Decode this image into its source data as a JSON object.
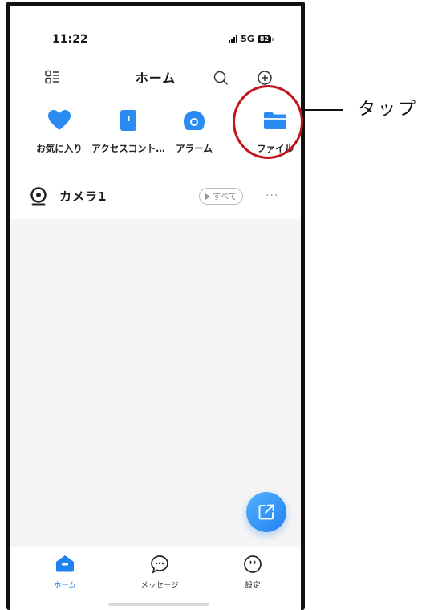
{
  "status_bar": {
    "time": "11:22",
    "network": "5G",
    "battery": "82"
  },
  "header": {
    "title": "ホーム",
    "icons": [
      "list-menu-icon",
      "search-icon",
      "add-icon"
    ]
  },
  "quick_actions": [
    {
      "label": "お気に入り",
      "icon": "heart-icon",
      "color": "#2a8bf2"
    },
    {
      "label": "アクセスコント…",
      "icon": "access-control-icon",
      "color": "#2a8bf2"
    },
    {
      "label": "アラーム",
      "icon": "alarm-icon",
      "color": "#2a8bf2"
    },
    {
      "label": "ファイル",
      "icon": "folder-icon",
      "color": "#2a8bf2"
    }
  ],
  "camera_row": {
    "name": "カメラ1",
    "view_all_label": "すべて",
    "more_label": "···"
  },
  "tab_bar": {
    "tabs": [
      {
        "label": "ホーム",
        "icon": "home-icon",
        "active": true
      },
      {
        "label": "メッセージ",
        "icon": "message-icon",
        "active": false
      },
      {
        "label": "設定",
        "icon": "settings-icon",
        "active": false
      }
    ]
  },
  "annotation": {
    "text": "タップ",
    "circle_color": "#c0141b"
  },
  "colors": {
    "accent": "#1f82f0",
    "background": "#f5f5f5"
  }
}
